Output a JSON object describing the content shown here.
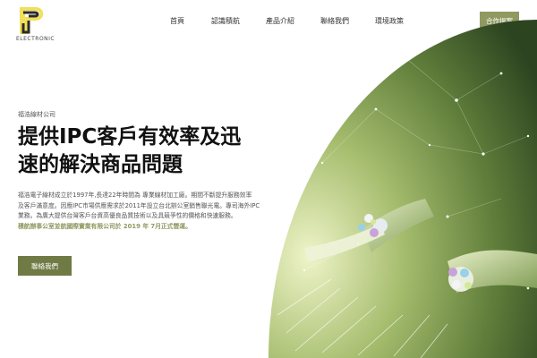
{
  "header": {
    "brand_name": "ELECTRONIC",
    "nav": [
      {
        "label": "首頁"
      },
      {
        "label": "認識積航"
      },
      {
        "label": "產品介紹"
      },
      {
        "label": "聯絡我們"
      },
      {
        "label": "環境政策"
      }
    ],
    "cta_label": "合作提案"
  },
  "hero": {
    "subtitle": "福浩線材公司",
    "headline_line1": "提供IPC客戶有效率及迅",
    "headline_line2": "速的解決商品問題",
    "body_lines": [
      "福浩電子線材成立於1997年,長達22年時間為 專業線材加工廠。期間不斷提升服務效率",
      "及客戶滿意度。因應IPC市場供應需求於2011年設立台北辦公室銷售聯光電。專司海外IPC",
      "業務。為廣大提供台灣客戶台資高優良品質技術以及具競爭性的價格和快速服務。"
    ],
    "highlight_line": "積航辦事公室並航國際實業有限公司於 2019 年 7月正式營運。",
    "contact_label": "聯絡我們"
  },
  "colors": {
    "accent": "#8f9960",
    "accent_dark": "#6f7a45",
    "fiber_green": "#c9d98a"
  },
  "icons": {
    "logo": "p-logo-icon"
  }
}
